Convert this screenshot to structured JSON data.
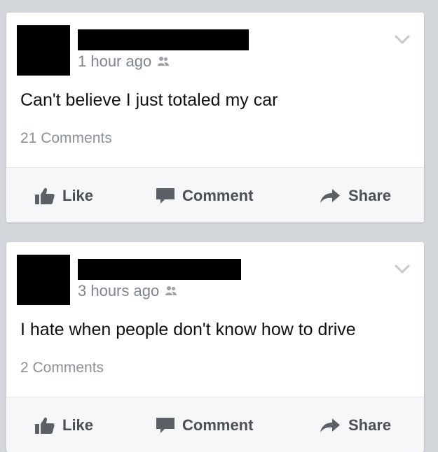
{
  "colors": {
    "background": "#d3d6db",
    "card": "#ffffff",
    "action_bar": "#f6f7f9",
    "meta_text": "#7e8591",
    "action_text": "#4b4f56",
    "icon": "#5b5f66"
  },
  "actions": {
    "like_label": "Like",
    "comment_label": "Comment",
    "share_label": "Share"
  },
  "posts": [
    {
      "timestamp": "1 hour ago",
      "text": "Can't believe I just totaled my car",
      "comments_label": "21 Comments"
    },
    {
      "timestamp": "3 hours ago",
      "text": "I hate when people don't know how to drive",
      "comments_label": "2 Comments"
    }
  ],
  "icons": {
    "privacy": "friends-icon",
    "options": "chevron-down-icon",
    "like": "thumbs-up-icon",
    "comment": "speech-bubble-icon",
    "share": "share-arrow-icon"
  }
}
